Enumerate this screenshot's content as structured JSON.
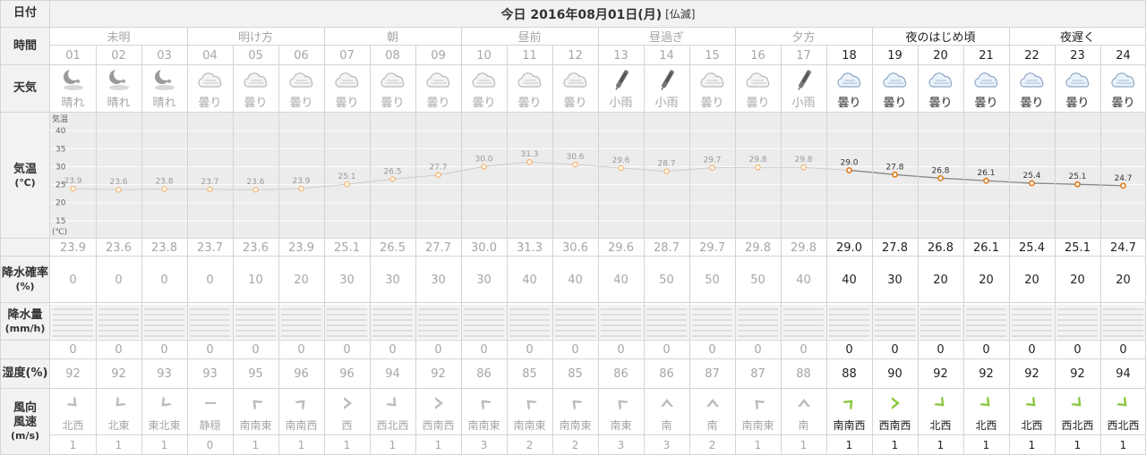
{
  "labels": {
    "date": "日付",
    "time": "時間",
    "weather": "天気",
    "temp": "気温",
    "temp_unit": "(℃)",
    "precip_prob": "降水確率",
    "precip_prob_unit": "(%)",
    "precip_amount": "降水量",
    "precip_amount_unit": "(mm/h)",
    "humidity": "湿度(%)",
    "wind_dir": "風向",
    "wind_speed": "風速",
    "wind_unit": "(m/s)"
  },
  "date_header": {
    "title": "今日 2016年08月01日(月)",
    "rokuyo": "[仏滅]"
  },
  "periods": [
    {
      "label": "未明"
    },
    {
      "label": "明け方"
    },
    {
      "label": "朝"
    },
    {
      "label": "昼前"
    },
    {
      "label": "昼過ぎ"
    },
    {
      "label": "夕方"
    },
    {
      "label": "夜のはじめ頃"
    },
    {
      "label": "夜遅く"
    }
  ],
  "temp_axis": {
    "label": "気温",
    "unit": "(℃)",
    "ticks": [
      "40",
      "35",
      "30",
      "25",
      "20",
      "15"
    ],
    "range": [
      10,
      45
    ]
  },
  "current_from_hour": "18",
  "hours": [
    {
      "hour": "01",
      "weather": "晴れ",
      "icon": "moon-icon",
      "temp": "23.9",
      "prob": "0",
      "rain": "0",
      "humid": "92",
      "wdir": "北西",
      "wspd": "1",
      "arrow": "arrow-southeast"
    },
    {
      "hour": "02",
      "weather": "晴れ",
      "icon": "moon-icon",
      "temp": "23.6",
      "prob": "0",
      "rain": "0",
      "humid": "92",
      "wdir": "北東",
      "wspd": "1",
      "arrow": "arrow-southwest"
    },
    {
      "hour": "03",
      "weather": "晴れ",
      "icon": "moon-icon",
      "temp": "23.8",
      "prob": "0",
      "rain": "0",
      "humid": "93",
      "wdir": "東北東",
      "wspd": "1",
      "arrow": "arrow-southwest"
    },
    {
      "hour": "04",
      "weather": "曇り",
      "icon": "cloud-icon",
      "temp": "23.7",
      "prob": "0",
      "rain": "0",
      "humid": "93",
      "wdir": "静穏",
      "wspd": "0",
      "arrow": "calm-dash"
    },
    {
      "hour": "05",
      "weather": "曇り",
      "icon": "cloud-icon",
      "temp": "23.6",
      "prob": "10",
      "rain": "0",
      "humid": "95",
      "wdir": "南南東",
      "wspd": "1",
      "arrow": "arrow-northwest"
    },
    {
      "hour": "06",
      "weather": "曇り",
      "icon": "cloud-icon",
      "temp": "23.9",
      "prob": "20",
      "rain": "0",
      "humid": "96",
      "wdir": "南南西",
      "wspd": "1",
      "arrow": "arrow-northeast"
    },
    {
      "hour": "07",
      "weather": "曇り",
      "icon": "cloud-icon",
      "temp": "25.1",
      "prob": "30",
      "rain": "0",
      "humid": "96",
      "wdir": "西",
      "wspd": "1",
      "arrow": "arrow-east"
    },
    {
      "hour": "08",
      "weather": "曇り",
      "icon": "cloud-icon",
      "temp": "26.5",
      "prob": "30",
      "rain": "0",
      "humid": "94",
      "wdir": "西北西",
      "wspd": "1",
      "arrow": "arrow-southeast"
    },
    {
      "hour": "09",
      "weather": "曇り",
      "icon": "cloud-icon",
      "temp": "27.7",
      "prob": "30",
      "rain": "0",
      "humid": "92",
      "wdir": "西南西",
      "wspd": "1",
      "arrow": "arrow-east"
    },
    {
      "hour": "10",
      "weather": "曇り",
      "icon": "cloud-icon",
      "temp": "30.0",
      "prob": "30",
      "rain": "0",
      "humid": "86",
      "wdir": "南南東",
      "wspd": "3",
      "arrow": "arrow-northwest"
    },
    {
      "hour": "11",
      "weather": "曇り",
      "icon": "cloud-icon",
      "temp": "31.3",
      "prob": "40",
      "rain": "0",
      "humid": "85",
      "wdir": "南南東",
      "wspd": "2",
      "arrow": "arrow-northwest"
    },
    {
      "hour": "12",
      "weather": "曇り",
      "icon": "cloud-icon",
      "temp": "30.6",
      "prob": "40",
      "rain": "0",
      "humid": "85",
      "wdir": "南南東",
      "wspd": "2",
      "arrow": "arrow-northwest"
    },
    {
      "hour": "13",
      "weather": "小雨",
      "icon": "umbrella-icon",
      "temp": "29.6",
      "prob": "40",
      "rain": "0",
      "humid": "86",
      "wdir": "南東",
      "wspd": "3",
      "arrow": "arrow-northwest"
    },
    {
      "hour": "14",
      "weather": "小雨",
      "icon": "umbrella-icon",
      "temp": "28.7",
      "prob": "50",
      "rain": "0",
      "humid": "86",
      "wdir": "南",
      "wspd": "3",
      "arrow": "arrow-north"
    },
    {
      "hour": "15",
      "weather": "曇り",
      "icon": "cloud-icon",
      "temp": "29.7",
      "prob": "50",
      "rain": "0",
      "humid": "87",
      "wdir": "南",
      "wspd": "2",
      "arrow": "arrow-north"
    },
    {
      "hour": "16",
      "weather": "曇り",
      "icon": "cloud-icon",
      "temp": "29.8",
      "prob": "50",
      "rain": "0",
      "humid": "87",
      "wdir": "南南東",
      "wspd": "1",
      "arrow": "arrow-northwest"
    },
    {
      "hour": "17",
      "weather": "小雨",
      "icon": "umbrella-icon",
      "temp": "29.8",
      "prob": "40",
      "rain": "0",
      "humid": "88",
      "wdir": "南",
      "wspd": "1",
      "arrow": "arrow-north"
    },
    {
      "hour": "18",
      "weather": "曇り",
      "icon": "cloud-icon",
      "temp": "29.0",
      "prob": "40",
      "rain": "0",
      "humid": "88",
      "wdir": "南南西",
      "wspd": "1",
      "arrow": "arrow-northeast"
    },
    {
      "hour": "19",
      "weather": "曇り",
      "icon": "cloud-icon",
      "temp": "27.8",
      "prob": "30",
      "rain": "0",
      "humid": "90",
      "wdir": "西南西",
      "wspd": "1",
      "arrow": "arrow-east"
    },
    {
      "hour": "20",
      "weather": "曇り",
      "icon": "cloud-icon",
      "temp": "26.8",
      "prob": "20",
      "rain": "0",
      "humid": "92",
      "wdir": "北西",
      "wspd": "1",
      "arrow": "arrow-southeast"
    },
    {
      "hour": "21",
      "weather": "曇り",
      "icon": "cloud-icon",
      "temp": "26.1",
      "prob": "20",
      "rain": "0",
      "humid": "92",
      "wdir": "北西",
      "wspd": "1",
      "arrow": "arrow-southeast"
    },
    {
      "hour": "22",
      "weather": "曇り",
      "icon": "cloud-icon",
      "temp": "25.4",
      "prob": "20",
      "rain": "0",
      "humid": "92",
      "wdir": "北西",
      "wspd": "1",
      "arrow": "arrow-southeast"
    },
    {
      "hour": "23",
      "weather": "曇り",
      "icon": "cloud-icon",
      "temp": "25.1",
      "prob": "20",
      "rain": "0",
      "humid": "92",
      "wdir": "西北西",
      "wspd": "1",
      "arrow": "arrow-southeast"
    },
    {
      "hour": "24",
      "weather": "曇り",
      "icon": "cloud-icon",
      "temp": "24.7",
      "prob": "20",
      "rain": "0",
      "humid": "94",
      "wdir": "西北西",
      "wspd": "1",
      "arrow": "arrow-southeast"
    }
  ],
  "colors": {
    "grid": "#d4d4d4",
    "label_bg": "#f2f2f2",
    "past_text": "#a6a6a6",
    "current_text": "#222222",
    "temp_dot_past": "#f5b266",
    "temp_dot_current": "#e07b1a",
    "temp_line_past": "#cccccc",
    "temp_line_current": "#888888",
    "wind_past": "#bbbbbb",
    "wind_current": "#8cc63f"
  },
  "chart_data": {
    "type": "line",
    "x": [
      "01",
      "02",
      "03",
      "04",
      "05",
      "06",
      "07",
      "08",
      "09",
      "10",
      "11",
      "12",
      "13",
      "14",
      "15",
      "16",
      "17",
      "18",
      "19",
      "20",
      "21",
      "22",
      "23",
      "24"
    ],
    "series": [
      {
        "values": [
          23.9,
          23.6,
          23.8,
          23.7,
          23.6,
          23.9,
          25.1,
          26.5,
          27.7,
          30.0,
          31.3,
          30.6,
          29.6,
          28.7,
          29.7,
          29.8,
          29.8,
          29.0,
          27.8,
          26.8,
          26.1,
          25.4,
          25.1,
          24.7
        ]
      }
    ],
    "ylabel": "気温",
    "ylim": [
      10,
      45
    ],
    "grid": true
  }
}
